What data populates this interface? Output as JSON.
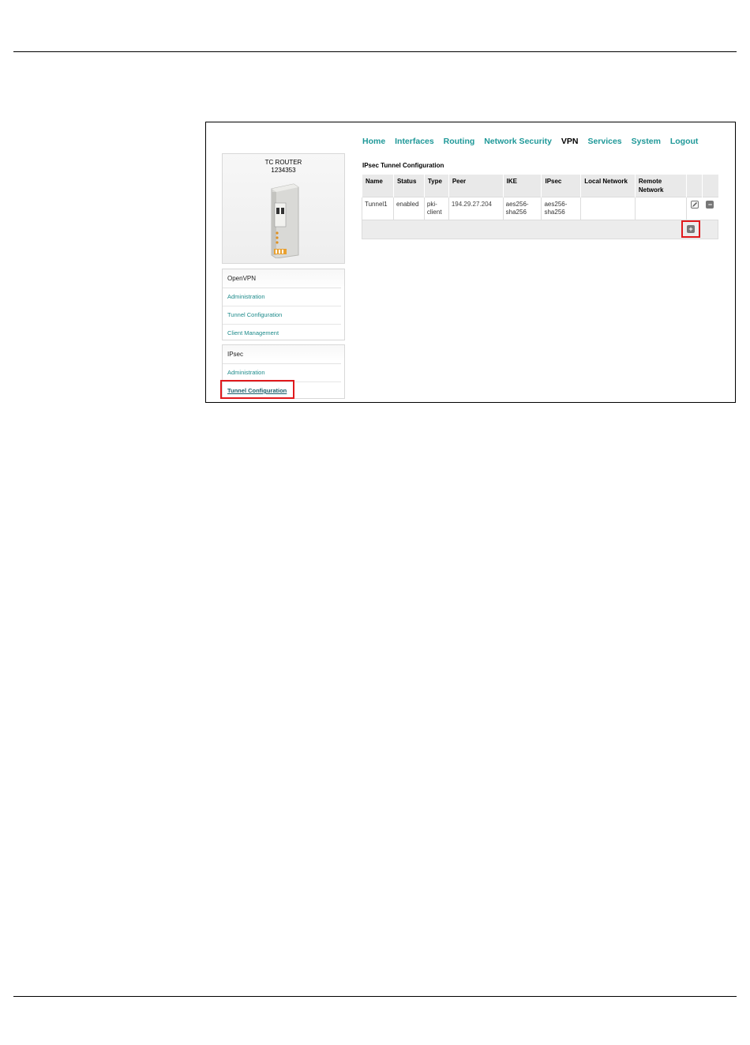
{
  "device": {
    "name": "TC ROUTER",
    "model": "1234353"
  },
  "nav": {
    "items": [
      "Home",
      "Interfaces",
      "Routing",
      "Network Security",
      "VPN",
      "Services",
      "System",
      "Logout"
    ],
    "current": "VPN"
  },
  "sidebar": {
    "openvpn": {
      "title": "OpenVPN",
      "items": [
        "Administration",
        "Tunnel Configuration",
        "Client Management"
      ]
    },
    "ipsec": {
      "title": "IPsec",
      "items": [
        "Administration",
        "Tunnel Configuration"
      ]
    }
  },
  "main": {
    "title": "IPsec Tunnel Configuration",
    "columns": [
      "Name",
      "Status",
      "Type",
      "Peer",
      "IKE",
      "IPsec",
      "Local Network",
      "Remote Network"
    ],
    "rows": [
      {
        "name": "Tunnel1",
        "status": "enabled",
        "type": "pki-client",
        "peer": "194.29.27.204",
        "ike": "aes256-sha256",
        "ipsec": "aes256-sha256",
        "local": "",
        "remote": ""
      }
    ]
  },
  "icons": {
    "edit": "edit-icon",
    "remove": "minus-icon",
    "add": "plus-icon"
  },
  "colors": {
    "link": "#1e9898",
    "highlight": "#e0191c"
  }
}
